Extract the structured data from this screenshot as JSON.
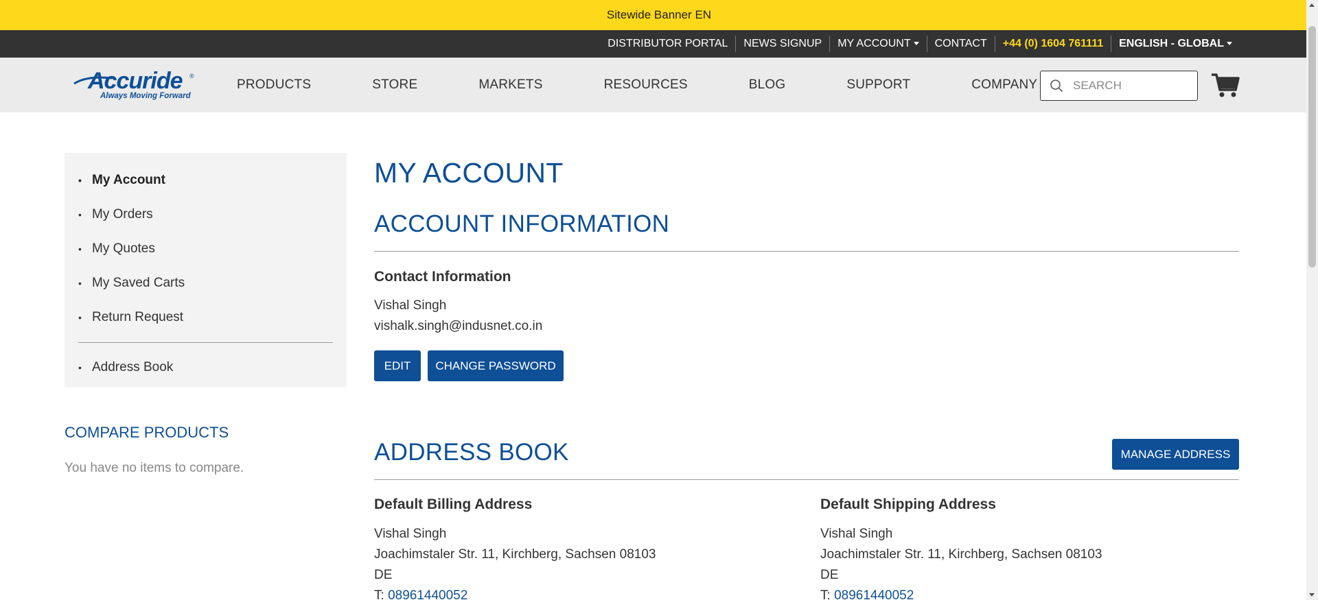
{
  "banner": {
    "text": "Sitewide Banner EN"
  },
  "topbar": {
    "links": [
      "DISTRIBUTOR PORTAL",
      "NEWS SIGNUP",
      "MY ACCOUNT",
      "CONTACT"
    ],
    "phone": "+44 (0) 1604 761111",
    "language": "ENGLISH - GLOBAL"
  },
  "header": {
    "logo": {
      "word": "Accuride",
      "tagline": "Always Moving Forward"
    },
    "nav": [
      "PRODUCTS",
      "STORE",
      "MARKETS",
      "RESOURCES",
      "BLOG",
      "SUPPORT",
      "COMPANY"
    ],
    "search_placeholder": "SEARCH"
  },
  "sidebar": {
    "items": [
      "My Account",
      "My Orders",
      "My Quotes",
      "My Saved Carts",
      "Return Request"
    ],
    "items_after_divider": [
      "Address Book"
    ],
    "active": "My Account"
  },
  "compare": {
    "title": "COMPARE PRODUCTS",
    "empty_text": "You have no items to compare."
  },
  "main": {
    "page_title": "MY ACCOUNT",
    "account_info": {
      "title": "ACCOUNT INFORMATION",
      "contact_heading": "Contact Information",
      "name": "Vishal Singh",
      "email": "vishalk.singh@indusnet.co.in",
      "edit_label": "EDIT",
      "change_password_label": "CHANGE PASSWORD"
    },
    "address_book": {
      "title": "ADDRESS BOOK",
      "manage_label": "MANAGE ADDRESS",
      "billing": {
        "heading": "Default Billing Address",
        "name": "Vishal Singh",
        "street": "Joachimstaler Str. 11, Kirchberg, Sachsen 08103",
        "country": "DE",
        "phone_prefix": "T: ",
        "phone": "08961440052"
      },
      "shipping": {
        "heading": "Default Shipping Address",
        "name": "Vishal Singh",
        "street": "Joachimstaler Str. 11, Kirchberg, Sachsen 08103",
        "country": "DE",
        "phone_prefix": "T: ",
        "phone": "08961440052"
      }
    }
  },
  "colors": {
    "brand_blue": "#0e4f96",
    "banner_yellow": "#fdd81b",
    "topbar_bg": "#333333"
  }
}
